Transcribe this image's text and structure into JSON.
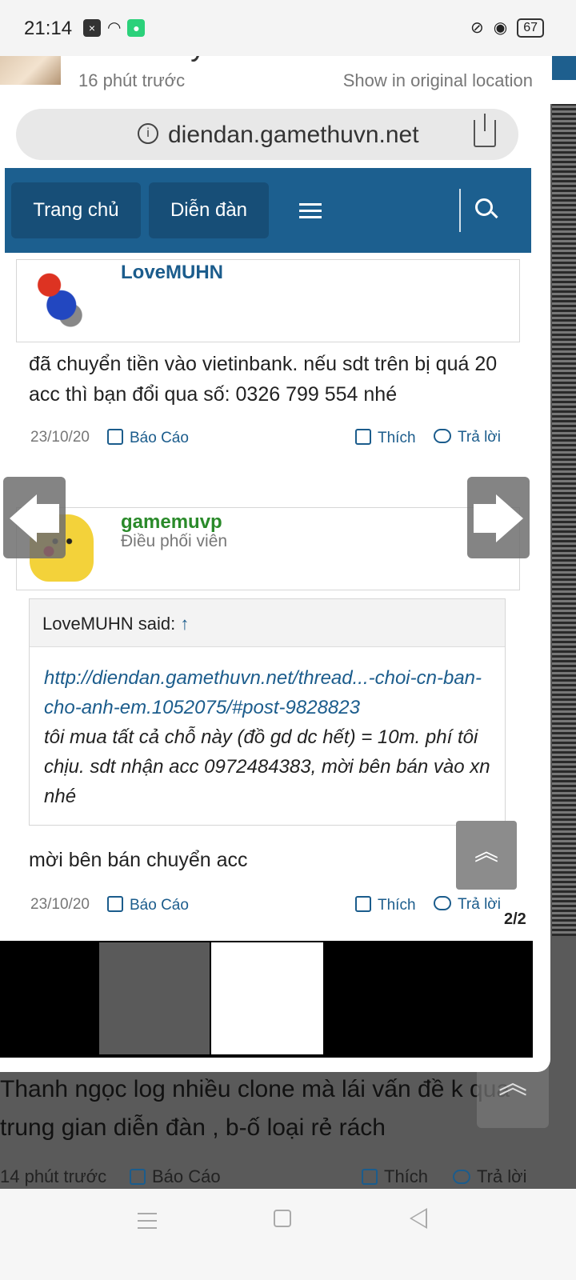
{
  "status_bar": {
    "time": "21:14",
    "battery": "67",
    "icons": [
      "notification-icon",
      "wifi-icon",
      "app-icon",
      "vibrate-icon",
      "alarm-icon",
      "battery-icon"
    ]
  },
  "feed_post": {
    "author": "CkCuaVy",
    "time_ago": "16 phút trước",
    "show_original": "Show in original location"
  },
  "viewer": {
    "counter": "2/2",
    "url": "diendan.gamethuvn.net",
    "nav": {
      "home": "Trang chủ",
      "forum": "Diễn đàn"
    },
    "post1": {
      "username": "LoveMUHN",
      "text": "đã chuyển tiền vào vietinbank. nếu sdt trên bị quá 20 acc thì bạn đổi qua số: 0326 799 554 nhé",
      "date": "23/10/20",
      "report": "Báo Cáo",
      "like": "Thích",
      "reply": "Trả lời"
    },
    "post2": {
      "username": "gamemuvp",
      "role": "Điều phối viên",
      "quote_author": "LoveMUHN said:",
      "quote_arrow": "↑",
      "quote_link": "http://diendan.gamethuvn.net/thread...-choi-cn-ban-cho-anh-em.1052075/#post-9828823",
      "quote_text": "tôi mua tất cả chỗ này (đồ gd dc hết) = 10m. phí tôi chịu. sdt nhận acc 0972484383, mời bên bán vào xn nhé",
      "text": "mời bên bán chuyển acc",
      "date": "23/10/20",
      "report": "Báo Cáo",
      "like": "Thích",
      "reply": "Trả lời"
    }
  },
  "background_comment": {
    "text": "Thanh ngọc log nhiều clone mà lái vấn đề k qua trung gian diễn đàn , b-ố loại rẻ rách",
    "time_ago": "14 phút trước",
    "report": "Báo Cáo",
    "like": "Thích",
    "reply": "Trả lời"
  },
  "colors": {
    "forum_blue": "#1c5f8f",
    "link_blue": "#1b5c8c"
  }
}
